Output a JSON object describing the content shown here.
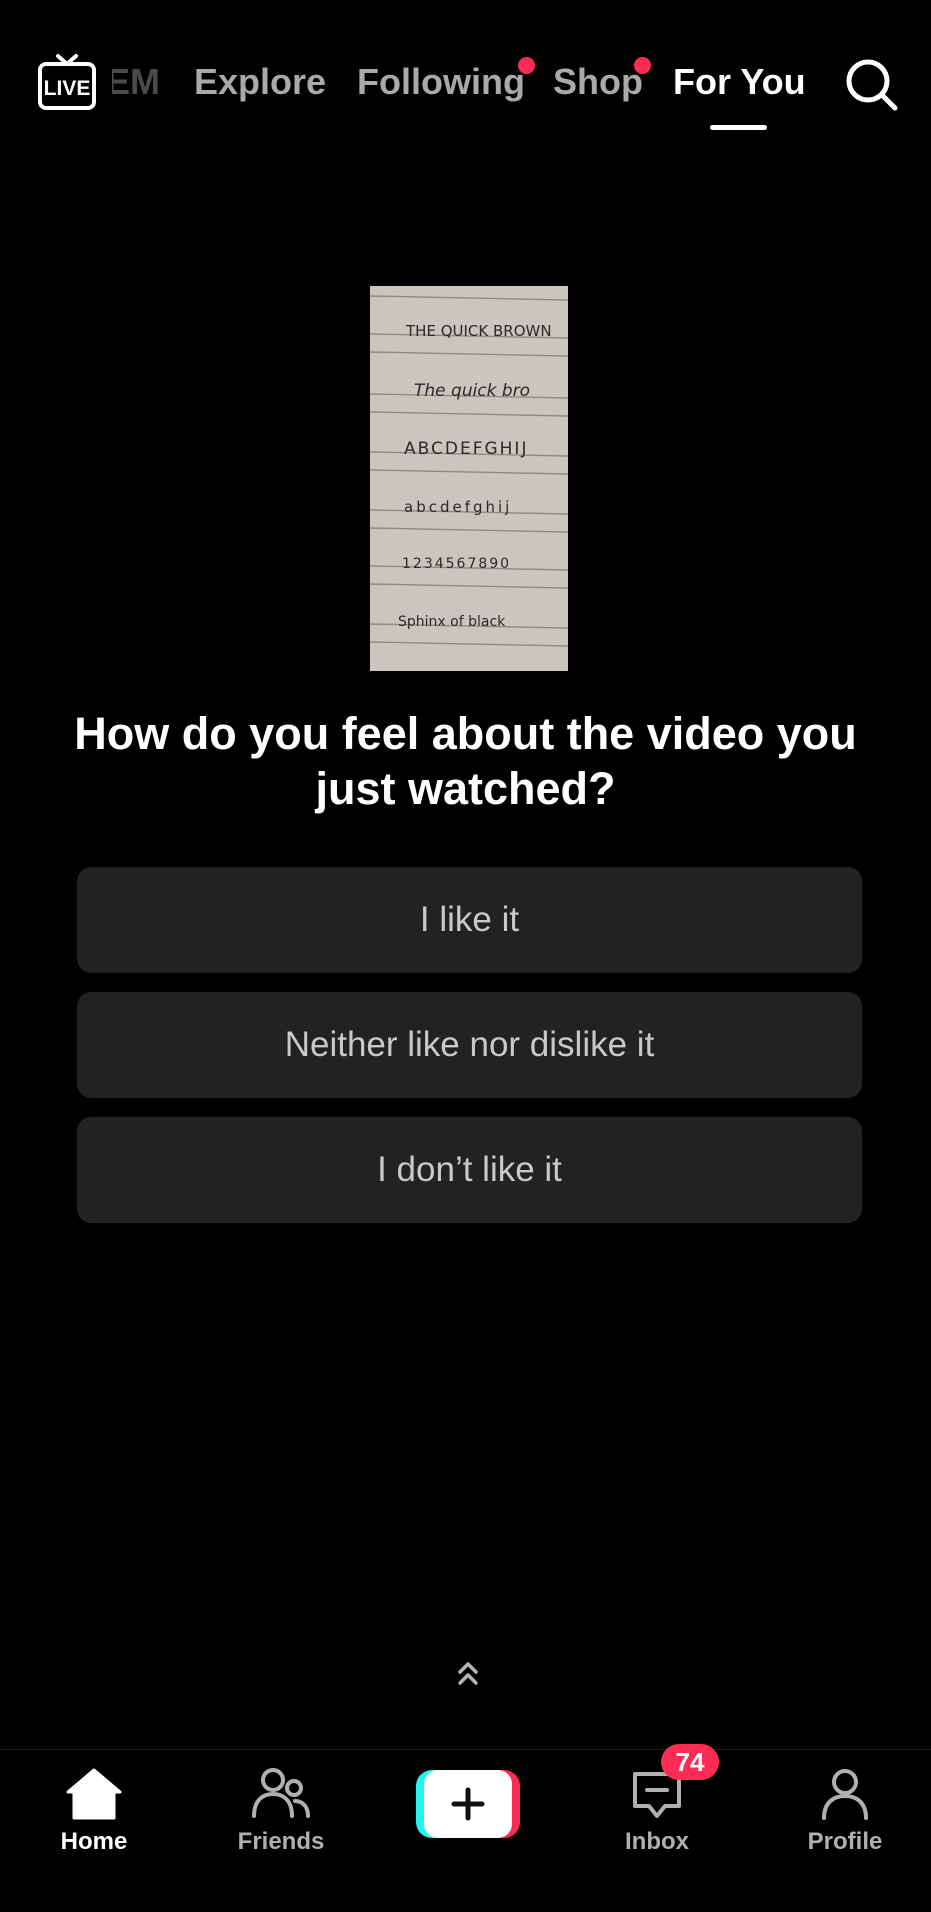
{
  "top_nav": {
    "tabs": [
      {
        "label": "EM",
        "active": false,
        "has_dot": false
      },
      {
        "label": "Explore",
        "active": false,
        "has_dot": false
      },
      {
        "label": "Following",
        "active": false,
        "has_dot": true
      },
      {
        "label": "Shop",
        "active": false,
        "has_dot": true
      },
      {
        "label": "For You",
        "active": true,
        "has_dot": false
      }
    ],
    "live_icon": "live-tv-icon",
    "search_icon": "search-icon"
  },
  "survey": {
    "question": "How do you feel about the video you just watched?",
    "options": [
      {
        "label": "I like it"
      },
      {
        "label": "Neither like nor dislike it"
      },
      {
        "label": "I don’t like it"
      }
    ]
  },
  "thumbnail": {
    "icon": "handwriting-practice-thumbnail",
    "lines": [
      "THE QUICK BROWN",
      "The quick bro",
      "ABCDEFGHIJ",
      "abcdefghij",
      "1234567890",
      "Sphinx of black"
    ]
  },
  "bottom_nav": {
    "home_label": "Home",
    "friends_label": "Friends",
    "inbox_label": "Inbox",
    "inbox_badge": "74",
    "profile_label": "Profile"
  },
  "colors": {
    "background": "#000000",
    "accent_red": "#fe2c55",
    "accent_cyan": "#25f4ee",
    "button_bg": "#222222"
  }
}
